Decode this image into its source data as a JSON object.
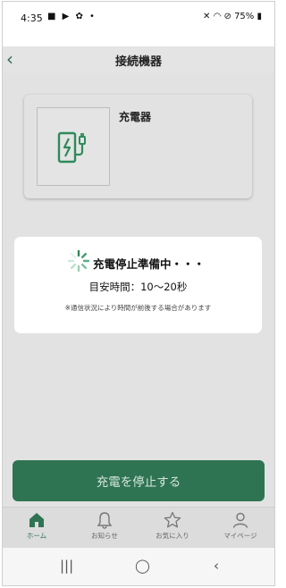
{
  "status_bar": {
    "time": "4:35",
    "left_icons": "■ ▶ ✿ •",
    "right_text": "75%"
  },
  "header": {
    "title": "接続機器"
  },
  "device": {
    "name": "充電器"
  },
  "modal": {
    "title": "充電停止準備中・・・",
    "subtitle": "目安時間：10〜20秒",
    "note": "※通信状況により時間が前後する場合があります"
  },
  "action_button": {
    "label": "充電を停止する"
  },
  "tabs": [
    {
      "label": "ホーム",
      "icon": "home-icon",
      "active": true
    },
    {
      "label": "お知らせ",
      "icon": "bell-icon",
      "active": false
    },
    {
      "label": "お気に入り",
      "icon": "star-icon",
      "active": false
    },
    {
      "label": "マイページ",
      "icon": "user-icon",
      "active": false
    }
  ],
  "colors": {
    "accent": "#2f7452",
    "charger_icon": "#2f8a5a"
  }
}
